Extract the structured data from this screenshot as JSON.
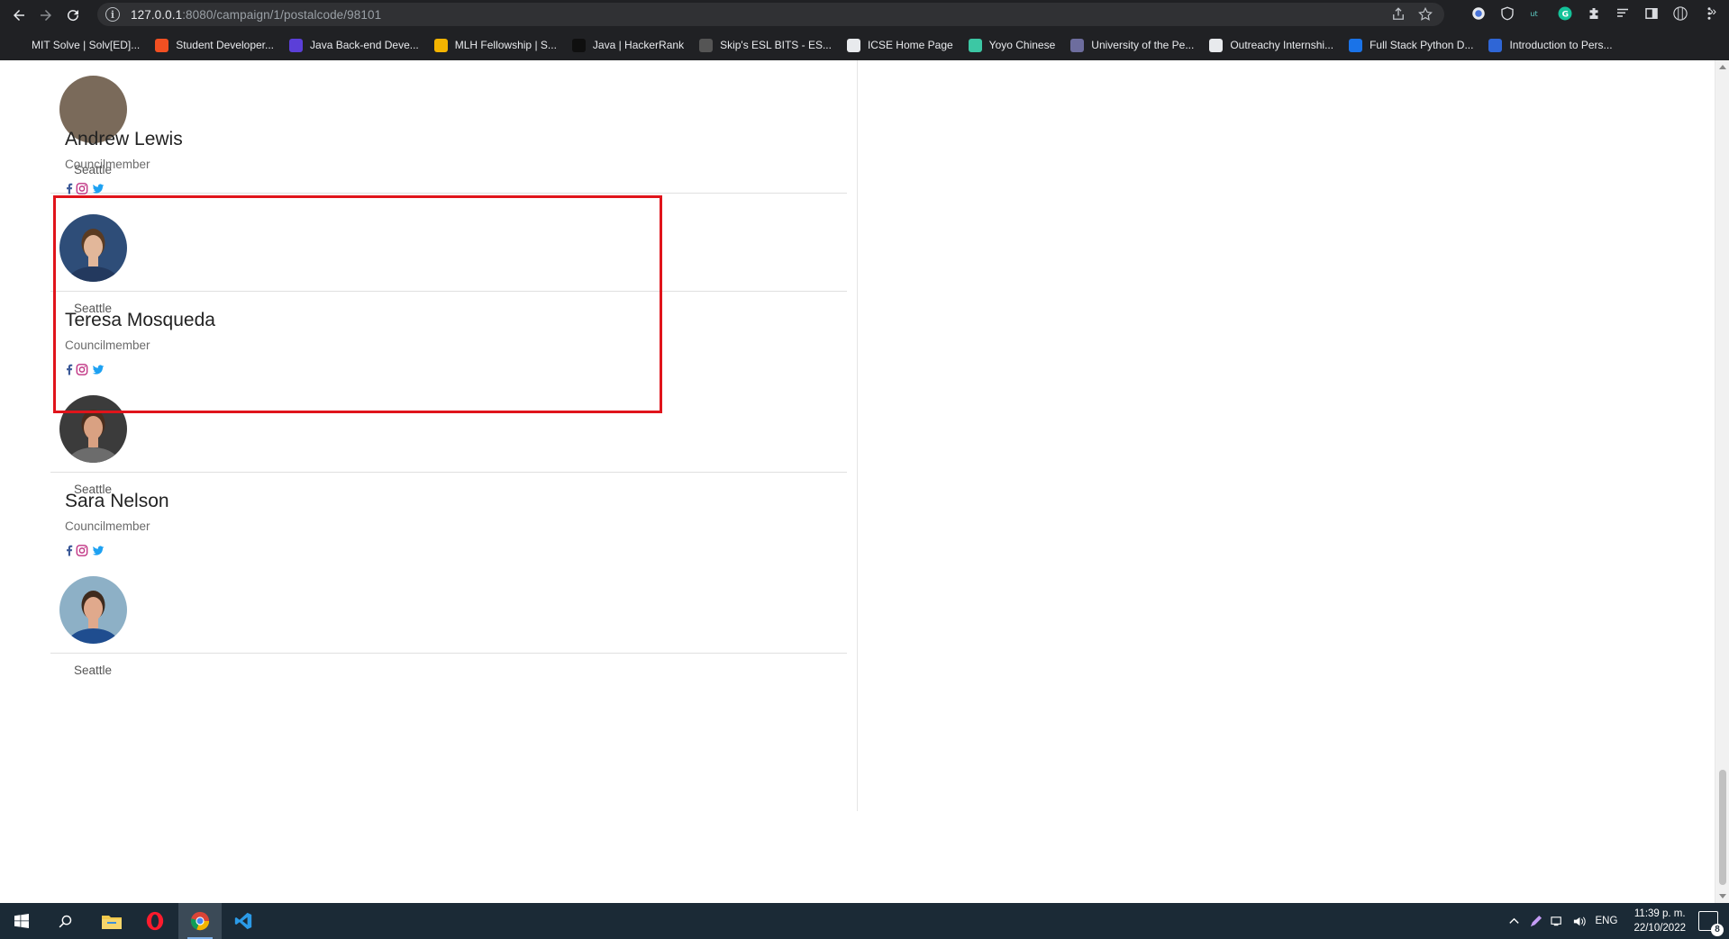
{
  "browser": {
    "url_host": "127.0.0.1",
    "url_path": ":8080/campaign/1/postalcode/98101",
    "bookmarks": [
      {
        "label": "MIT Solve | Solv[ED]...",
        "color": "#202124"
      },
      {
        "label": "Student Developer...",
        "color": "#f25022"
      },
      {
        "label": "Java Back-end Deve...",
        "color": "#5b3fd8"
      },
      {
        "label": "MLH Fellowship | S...",
        "color": "#f4b400"
      },
      {
        "label": "Java | HackerRank",
        "color": "#0f0f0f"
      },
      {
        "label": "Skip's ESL BITS - ES...",
        "color": "#555555"
      },
      {
        "label": "ICSE Home Page",
        "color": "#e8eaed"
      },
      {
        "label": "Yoyo Chinese",
        "color": "#3cc7a4"
      },
      {
        "label": "University of the Pe...",
        "color": "#6d6d9e"
      },
      {
        "label": "Outreachy Internshi...",
        "color": "#e8eaed"
      },
      {
        "label": "Full Stack Python D...",
        "color": "#1a73e8"
      },
      {
        "label": "Introduction to Pers...",
        "color": "#2f66d6"
      }
    ],
    "bookmarks_overflow": "»"
  },
  "prev_card": {
    "city": "Seattle"
  },
  "cards": [
    {
      "name": "Andrew Lewis",
      "role": "Councilmember",
      "city": "Seattle",
      "avatar_bg": "#2e4d78",
      "avatar_skin": "#e2b79a",
      "avatar_hair": "#5a3b22",
      "avatar_shirt": "#23395e"
    },
    {
      "name": "Teresa Mosqueda",
      "role": "Councilmember",
      "city": "Seattle",
      "avatar_bg": "#3b3b3b",
      "avatar_skin": "#d9a182",
      "avatar_hair": "#4a2d1c",
      "avatar_shirt": "#6c6c6c"
    },
    {
      "name": "Sara Nelson",
      "role": "Councilmember",
      "city": "Seattle",
      "avatar_bg": "#8db0c6",
      "avatar_skin": "#e0a98c",
      "avatar_hair": "#3e2a1d",
      "avatar_shirt": "#1f4d8f"
    }
  ],
  "social_colors": {
    "facebook": "#3b5998",
    "instagram": "#c13584",
    "twitter": "#1da1f2"
  },
  "footer_icons": [
    "facebook-icon",
    "twitter-icon",
    "linkedin-icon",
    "instagram-icon"
  ],
  "footer_icon_color": "#1c3d6e",
  "highlight_color": "#e0141b",
  "taskbar": {
    "lang": "ENG",
    "time": "11:39 p. m.",
    "date": "22/10/2022",
    "notifications": "8"
  }
}
